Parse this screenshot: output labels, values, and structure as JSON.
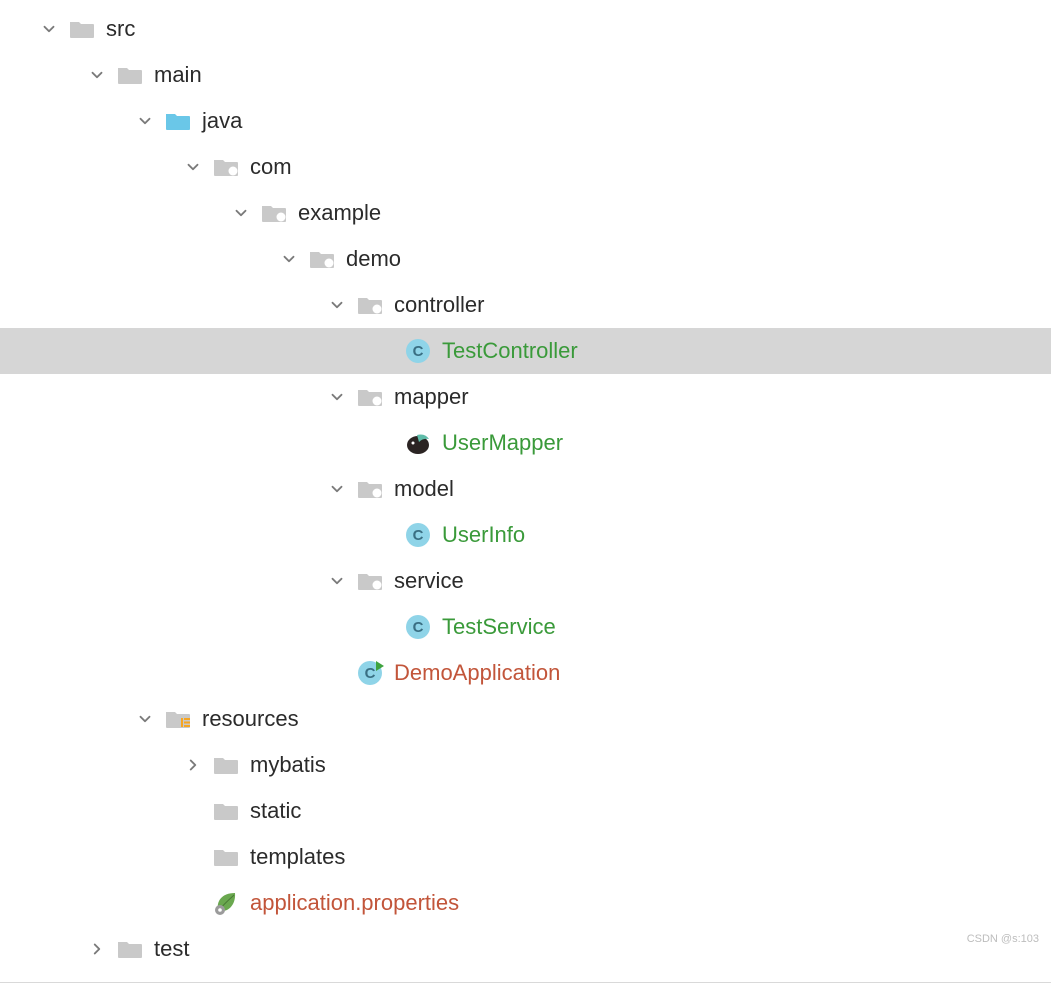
{
  "watermark": "CSDN @s:103",
  "tree": [
    {
      "id": "src",
      "depth": 0,
      "arrow": "down",
      "icon": "folder",
      "label": "src",
      "textClass": "c-default",
      "selected": false
    },
    {
      "id": "main",
      "depth": 1,
      "arrow": "down",
      "icon": "folder",
      "label": "main",
      "textClass": "c-default",
      "selected": false
    },
    {
      "id": "java",
      "depth": 2,
      "arrow": "down",
      "icon": "folder-blue",
      "label": "java",
      "textClass": "c-default",
      "selected": false
    },
    {
      "id": "com",
      "depth": 3,
      "arrow": "down",
      "icon": "folder-arc",
      "label": "com",
      "textClass": "c-default",
      "selected": false
    },
    {
      "id": "example",
      "depth": 4,
      "arrow": "down",
      "icon": "folder-arc",
      "label": "example",
      "textClass": "c-default",
      "selected": false
    },
    {
      "id": "demo",
      "depth": 5,
      "arrow": "down",
      "icon": "folder-arc",
      "label": "demo",
      "textClass": "c-default",
      "selected": false
    },
    {
      "id": "controller",
      "depth": 6,
      "arrow": "down",
      "icon": "folder-arc",
      "label": "controller",
      "textClass": "c-default",
      "selected": false
    },
    {
      "id": "TestCtrl",
      "depth": 7,
      "arrow": "none",
      "icon": "class",
      "label": "TestController",
      "textClass": "c-green",
      "selected": true
    },
    {
      "id": "mapper",
      "depth": 6,
      "arrow": "down",
      "icon": "folder-arc",
      "label": "mapper",
      "textClass": "c-default",
      "selected": false
    },
    {
      "id": "UserMapper",
      "depth": 7,
      "arrow": "none",
      "icon": "bird",
      "label": "UserMapper",
      "textClass": "c-green",
      "selected": false
    },
    {
      "id": "model",
      "depth": 6,
      "arrow": "down",
      "icon": "folder-arc",
      "label": "model",
      "textClass": "c-default",
      "selected": false
    },
    {
      "id": "UserInfo",
      "depth": 7,
      "arrow": "none",
      "icon": "class",
      "label": "UserInfo",
      "textClass": "c-green",
      "selected": false
    },
    {
      "id": "service",
      "depth": 6,
      "arrow": "down",
      "icon": "folder-arc",
      "label": "service",
      "textClass": "c-default",
      "selected": false
    },
    {
      "id": "TestSvc",
      "depth": 7,
      "arrow": "none",
      "icon": "class",
      "label": "TestService",
      "textClass": "c-green",
      "selected": false
    },
    {
      "id": "DemoApp",
      "depth": 6,
      "arrow": "none",
      "icon": "class-run",
      "label": "DemoApplication",
      "textClass": "c-orange",
      "selected": false
    },
    {
      "id": "resources",
      "depth": 2,
      "arrow": "down",
      "icon": "folder-res",
      "label": "resources",
      "textClass": "c-default",
      "selected": false
    },
    {
      "id": "mybatis",
      "depth": 3,
      "arrow": "right",
      "icon": "folder",
      "label": "mybatis",
      "textClass": "c-default",
      "selected": false
    },
    {
      "id": "static",
      "depth": 3,
      "arrow": "none",
      "icon": "folder",
      "label": "static",
      "textClass": "c-default",
      "selected": false
    },
    {
      "id": "templates",
      "depth": 3,
      "arrow": "none",
      "icon": "folder",
      "label": "templates",
      "textClass": "c-default",
      "selected": false
    },
    {
      "id": "appprops",
      "depth": 3,
      "arrow": "none",
      "icon": "leaf",
      "label": "application.properties",
      "textClass": "c-orange",
      "selected": false
    },
    {
      "id": "test",
      "depth": 1,
      "arrow": "right",
      "icon": "folder",
      "label": "test",
      "textClass": "c-default",
      "selected": false
    }
  ]
}
